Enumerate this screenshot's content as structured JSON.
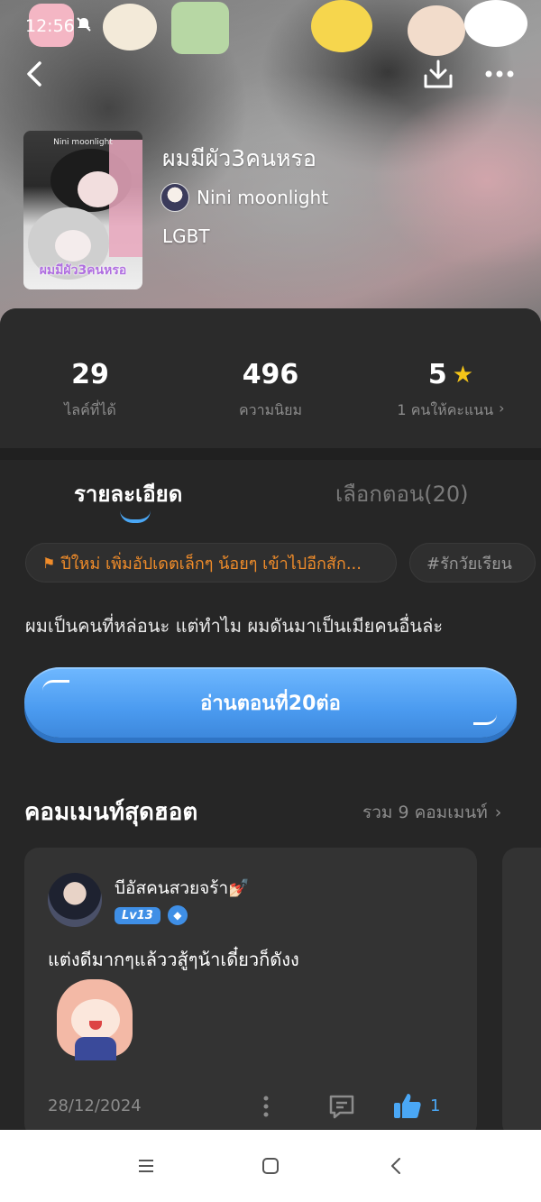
{
  "status": {
    "time": "12:56",
    "mute_icon": "mute-icon"
  },
  "book": {
    "title": "ผมมีผัว3คนหรอ",
    "author": "Nini moonlight",
    "genre": "LGBT",
    "cover_top_text": "Nini moonlight",
    "cover_title": "ผมมีผัว3คนหรอ"
  },
  "stats": {
    "likes_value": "29",
    "likes_label": "ไลค์ที่ได้",
    "popularity_value": "496",
    "popularity_label": "ความนิยม",
    "rating_value": "5",
    "rating_label": "1 คนให้คะแนน"
  },
  "tabs": {
    "details": "รายละเอียด",
    "episodes": "เลือกตอน(20)"
  },
  "tags": {
    "news": "ปีใหม่ เพิ่มอัปเดตเล็กๆ น้อยๆ เข้าไปอีกสัก...",
    "hashtag": "#รักวัยเรียน"
  },
  "description": "ผมเป็นคนที่หล่อนะ แต่ทำไม ผมดันมาเป็นเมียคนอื่นล่ะ",
  "read_button": "อ่านตอนที่20ต่อ",
  "comments": {
    "section_title": "คอมเมนท์สุดฮอต",
    "total_label": "รวม 9 คอมเมนท์",
    "items": [
      {
        "name": "บีอัสคนสวยจร้า💅🏻",
        "level": "Lv13",
        "text": "แต่งดีมากๆแล้ววสู้ๆน้าเดี๋ยวก็ดังง",
        "date": "28/12/2024",
        "likes": "1"
      }
    ]
  },
  "colors": {
    "accent": "#4aa7f5",
    "news": "#f08c2a",
    "star": "#f5c518",
    "background": "#262626"
  }
}
